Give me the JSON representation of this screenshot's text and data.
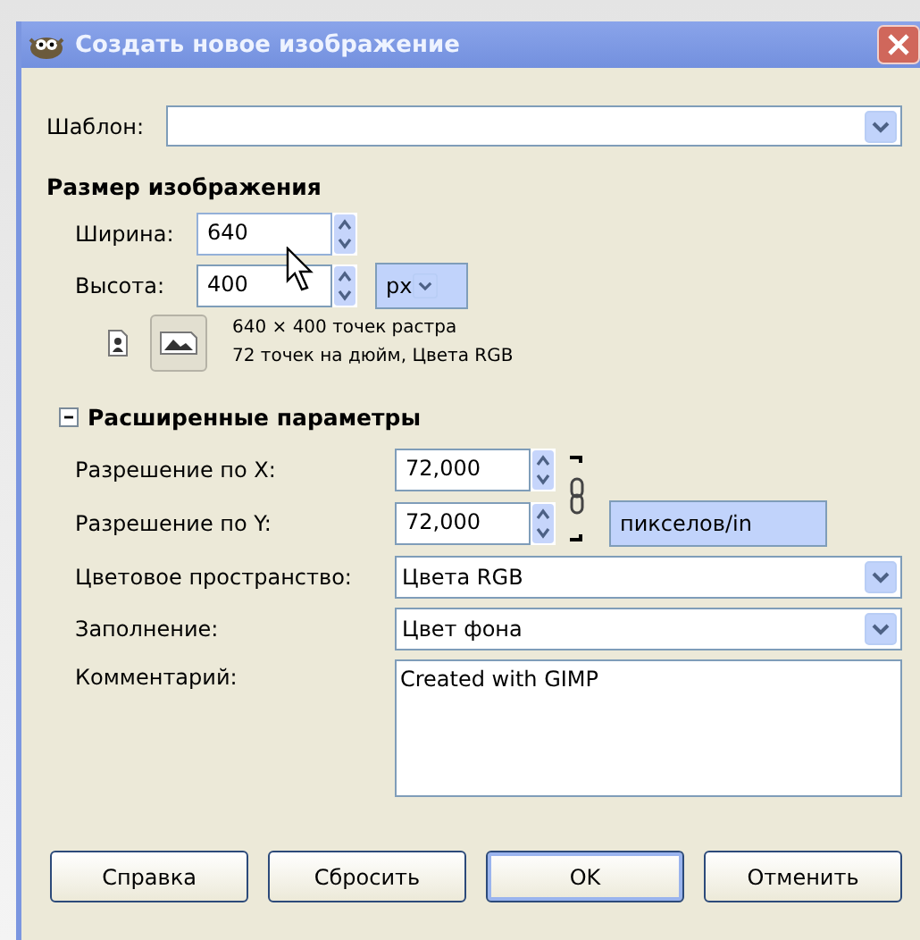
{
  "window": {
    "title": "Создать новое изображение"
  },
  "template": {
    "label": "Шаблон:"
  },
  "image_size": {
    "heading": "Размер изображения",
    "width": {
      "label": "Ширина:",
      "value": "640"
    },
    "height": {
      "label": "Высота:",
      "value": "400"
    },
    "unit": "px",
    "orientation": [
      {
        "kind": "portrait",
        "selected": false
      },
      {
        "kind": "landscape",
        "selected": true
      }
    ],
    "info": [
      "640 × 400 точек растра",
      "72 точек на дюйм, Цвета RGB"
    ]
  },
  "advanced": {
    "label": "Расширенные параметры",
    "expanded": true,
    "x_resolution": {
      "label": "Разрешение по X:",
      "value": "72,000"
    },
    "y_resolution": {
      "label": "Разрешение по Y:",
      "value": "72,000"
    },
    "linked": true,
    "resolution_unit": "пикселов/in",
    "color_space": {
      "label": "Цветовое пространство:",
      "value": "Цвета RGB"
    },
    "fill": {
      "label": "Заполнение:",
      "value": "Цвет фона"
    },
    "comment": {
      "label": "Комментарий:",
      "value": "Created with GIMP"
    }
  },
  "buttons": [
    {
      "label": "Справка",
      "default": false
    },
    {
      "label": "Сбросить",
      "default": false
    },
    {
      "label": "OK",
      "default": true
    },
    {
      "label": "Отменить",
      "default": false
    }
  ]
}
